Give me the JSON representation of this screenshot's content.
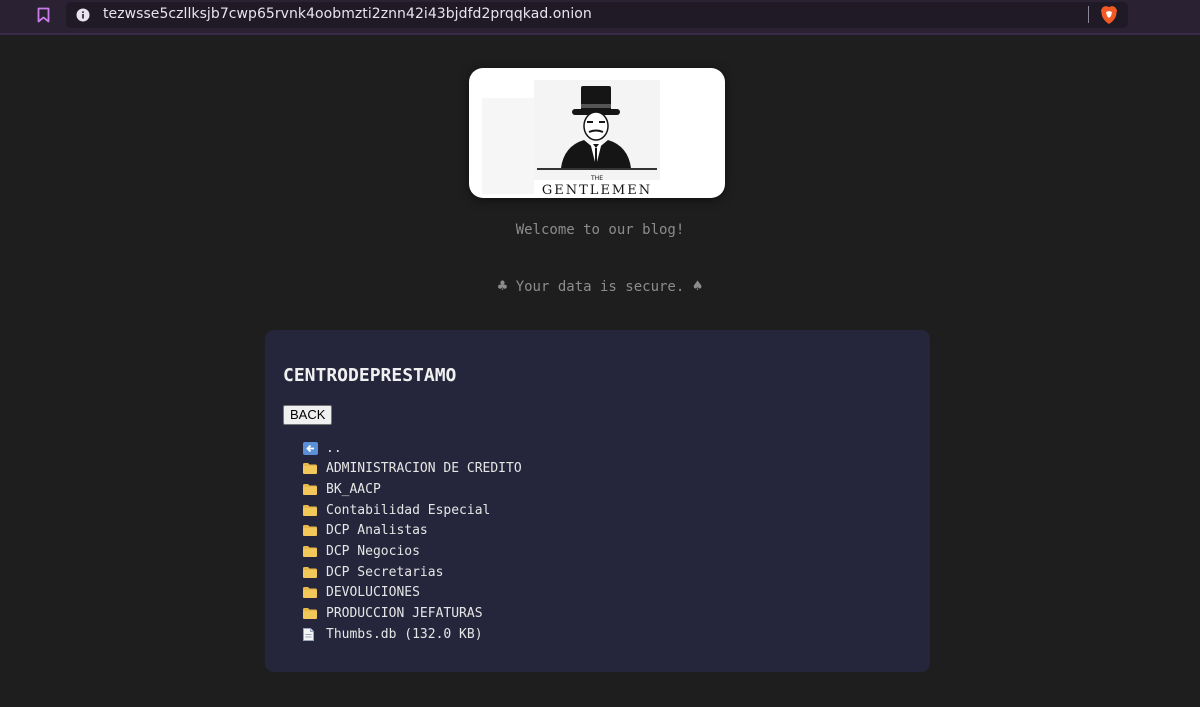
{
  "browser": {
    "url": "tezwsse5czllksjb7cwp65rvnk4oobmzti2znn42i43bjdfd2prqqkad.onion"
  },
  "logo": {
    "line1": "THE",
    "line2": "GENTLEMEN"
  },
  "welcome_text": "Welcome to our blog!",
  "secure": {
    "left_symbol": "♣",
    "text": "Your data is secure.",
    "right_symbol": "♠"
  },
  "panel": {
    "title": "CENTRODEPRESTAMO",
    "back_label": "BACK",
    "entries": [
      {
        "icon": "up-arrow-icon",
        "label": ".."
      },
      {
        "icon": "folder-icon",
        "label": "ADMINISTRACION DE CREDITO"
      },
      {
        "icon": "folder-icon",
        "label": "BK_AACP"
      },
      {
        "icon": "folder-icon",
        "label": "Contabilidad Especial"
      },
      {
        "icon": "folder-icon",
        "label": "DCP Analistas"
      },
      {
        "icon": "folder-icon",
        "label": "DCP Negocios"
      },
      {
        "icon": "folder-icon",
        "label": "DCP Secretarias"
      },
      {
        "icon": "folder-icon",
        "label": "DEVOLUCIONES"
      },
      {
        "icon": "folder-icon",
        "label": "PRODUCCION JEFATURAS"
      },
      {
        "icon": "file-icon",
        "label": "Thumbs.db (132.0 KB)"
      }
    ]
  },
  "colors": {
    "page_bg": "#1e1e1e",
    "panel_bg": "#25253c",
    "chrome_bg": "#2a2133",
    "muted_text": "#8c8c8c",
    "folder": "#e8b94a"
  }
}
